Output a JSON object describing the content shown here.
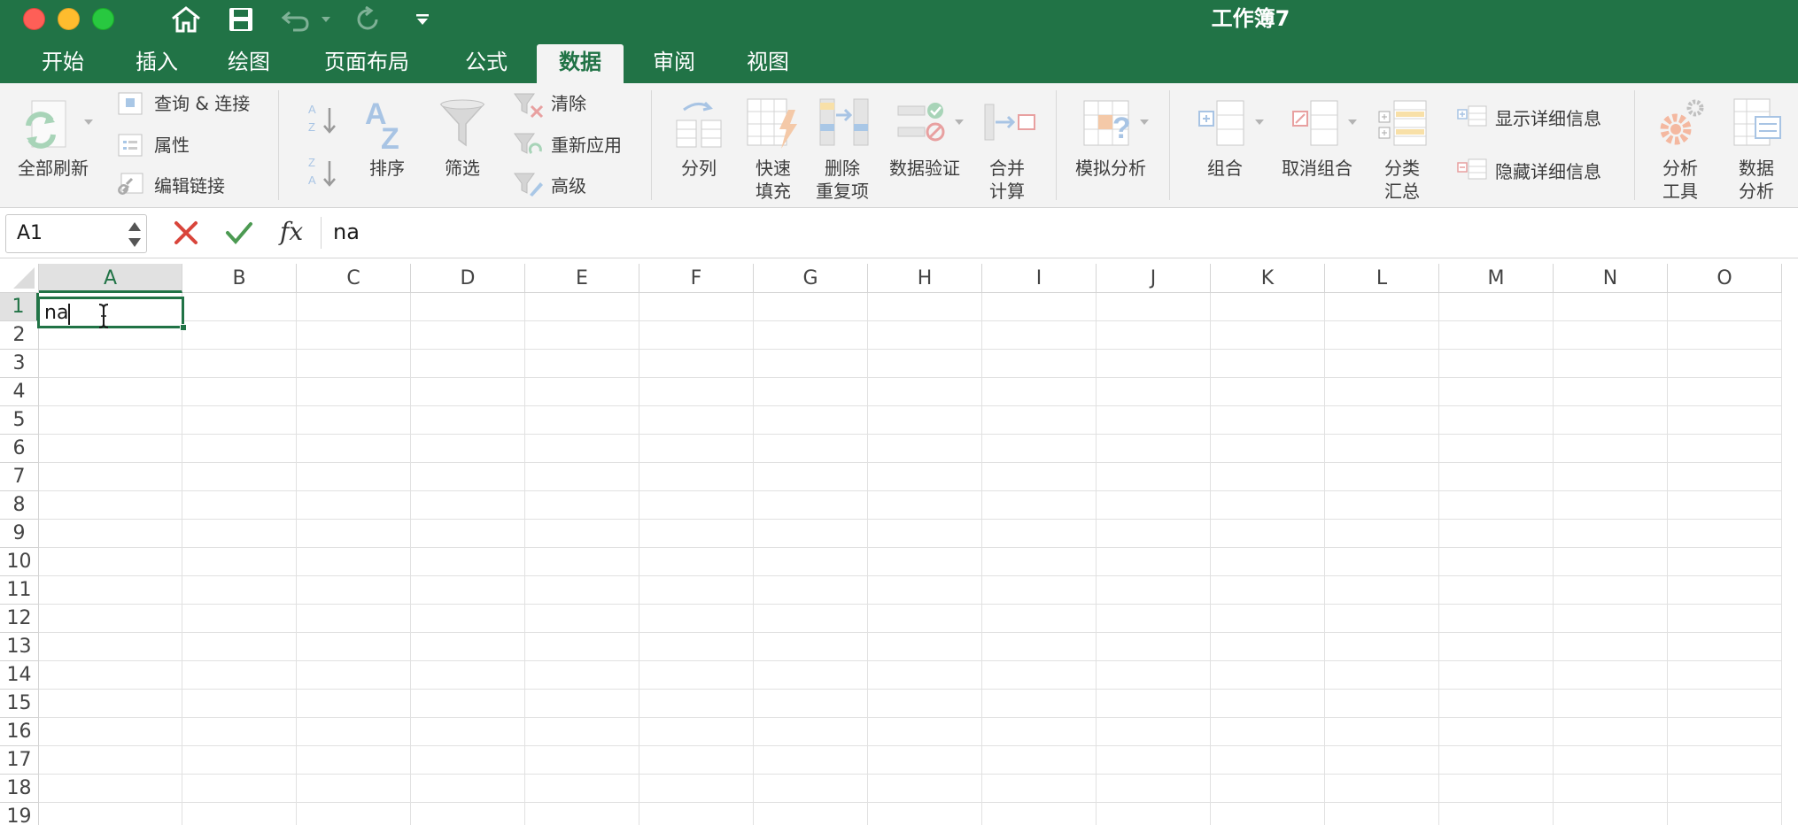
{
  "window": {
    "title": "工作簿7",
    "controls": [
      "close",
      "minimize",
      "maximize"
    ],
    "quick_access": [
      "home-icon",
      "save-icon",
      "undo-icon",
      "undo-dropdown-icon",
      "redo-icon",
      "customize-toolbar-icon"
    ]
  },
  "tabs": [
    {
      "label": "开始",
      "active": false
    },
    {
      "label": "插入",
      "active": false
    },
    {
      "label": "绘图",
      "active": false
    },
    {
      "label": "页面布局",
      "active": false
    },
    {
      "label": "公式",
      "active": false
    },
    {
      "label": "数据",
      "active": true
    },
    {
      "label": "审阅",
      "active": false
    },
    {
      "label": "视图",
      "active": false
    }
  ],
  "ribbon": {
    "refresh_all": "全部刷新",
    "queries_connections": "查询 & 连接",
    "properties": "属性",
    "edit_links": "编辑链接",
    "sort": "排序",
    "filter": "筛选",
    "clear": "清除",
    "reapply": "重新应用",
    "advanced": "高级",
    "text_to_columns": "分列",
    "flash_fill_line1": "快速",
    "flash_fill_line2": "填充",
    "remove_dup_line1": "删除",
    "remove_dup_line2": "重复项",
    "data_validation": "数据验证",
    "consolidate_line1": "合并",
    "consolidate_line2": "计算",
    "what_if": "模拟分析",
    "group": "组合",
    "ungroup": "取消组合",
    "subtotal_line1": "分类",
    "subtotal_line2": "汇总",
    "show_detail": "显示详细信息",
    "hide_detail": "隐藏详细信息",
    "analysis_tools_line1": "分析",
    "analysis_tools_line2": "工具",
    "data_analysis_line1": "数据",
    "data_analysis_line2": "分析",
    "accent_color": "#217346"
  },
  "formula_bar": {
    "name_box": "A1",
    "fx": "fx",
    "value": "na"
  },
  "sheet": {
    "columns": [
      "A",
      "B",
      "C",
      "D",
      "E",
      "F",
      "G",
      "H",
      "I",
      "J",
      "K",
      "L",
      "M",
      "N",
      "O"
    ],
    "rows": [
      "1",
      "2",
      "3",
      "4",
      "5",
      "6",
      "7",
      "8",
      "9",
      "10",
      "11",
      "12",
      "13",
      "14",
      "15",
      "16",
      "17",
      "18",
      "19"
    ],
    "active_cell": "A1",
    "active_cell_text": "na"
  }
}
